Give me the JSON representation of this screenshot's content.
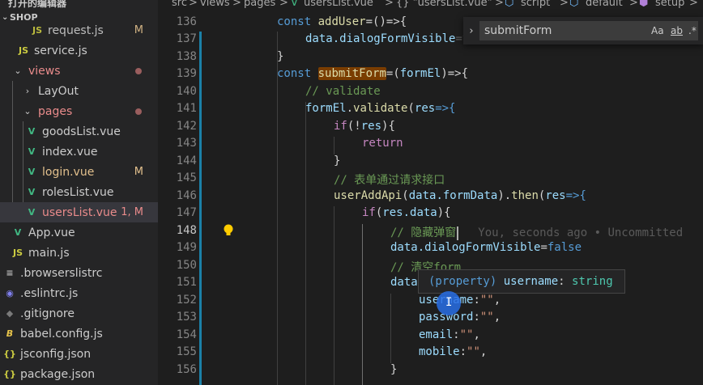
{
  "window": {
    "title": "打开的编辑器"
  },
  "sidebar": {
    "section": "SHOP",
    "items": [
      {
        "label": "request.js",
        "type": "js",
        "badge": "M",
        "partial": true
      },
      {
        "label": "service.js",
        "type": "js"
      },
      {
        "label": "views",
        "type": "folder-open",
        "dot": true
      },
      {
        "label": "LayOut",
        "type": "folder-closed"
      },
      {
        "label": "pages",
        "type": "folder-open",
        "dot": true
      },
      {
        "label": "goodsList.vue",
        "type": "vue"
      },
      {
        "label": "index.vue",
        "type": "vue"
      },
      {
        "label": "login.vue",
        "type": "vue",
        "badge": "M"
      },
      {
        "label": "rolesList.vue",
        "type": "vue"
      },
      {
        "label": "usersList.vue",
        "type": "vue",
        "badge": "1, M",
        "selected": true
      },
      {
        "label": "App.vue",
        "type": "vue"
      },
      {
        "label": "main.js",
        "type": "js"
      },
      {
        "label": ".browserslistrc",
        "type": "config"
      },
      {
        "label": ".eslintrc.js",
        "type": "eslint"
      },
      {
        "label": ".gitignore",
        "type": "git"
      },
      {
        "label": "babel.config.js",
        "type": "babel"
      },
      {
        "label": "jsconfig.json",
        "type": "json"
      },
      {
        "label": "package.json",
        "type": "json"
      }
    ]
  },
  "breadcrumb": {
    "items": [
      "src",
      "views",
      "pages",
      "usersList.vue",
      "{} \"usersList.vue\"",
      "script",
      "default",
      "setup"
    ],
    "separator": ">"
  },
  "editor": {
    "line_numbers": [
      "136",
      "137",
      "138",
      "139",
      "140",
      "141",
      "142",
      "143",
      "144",
      "145",
      "146",
      "147",
      "148",
      "149",
      "150",
      "151",
      "152",
      "153",
      "154",
      "155",
      "156"
    ],
    "lines": {
      "l136": {
        "kw": "const",
        "fn": "addUser",
        "rest": "=()=>{"
      },
      "l137": {
        "var": "data.dialogFormVisible",
        "rest": "=true"
      },
      "l138": {
        "text": "}"
      },
      "l139": {
        "kw": "const",
        "fn": "submitForm",
        "a": "=(",
        "var": "formEl",
        "b": ")=>{"
      },
      "l140": {
        "comment": "// validate"
      },
      "l141": {
        "var": "formEl",
        "a": ".",
        "fn": "validate",
        "b": "(",
        "var2": "res",
        "c": "=>{"
      },
      "l142": {
        "ctl": "if",
        "a": "(!",
        "var": "res",
        "b": "){"
      },
      "l143": {
        "ctl": "return"
      },
      "l144": {
        "text": "}"
      },
      "l145": {
        "comment": "// 表单通过请求接口"
      },
      "l146": {
        "fn": "userAddApi",
        "a": "(",
        "var": "data.formData",
        "b": ").",
        "fn2": "then",
        "c": "(",
        "var2": "res",
        "d": "=>{"
      },
      "l147": {
        "ctl": "if",
        "a": "(",
        "var": "res.data",
        "b": "){"
      },
      "l148": {
        "comment": "// 隐藏弹窗",
        "blame": "You, seconds ago • Uncommitted"
      },
      "l149": {
        "var": "data.dialogFormVisible",
        "a": "=",
        "kw": "false"
      },
      "l150": {
        "comment": "// 清空form"
      },
      "l151": {
        "var": "data"
      },
      "l152": {
        "var": "username",
        "a": ":",
        "str": "\"\"",
        "b": ","
      },
      "l153": {
        "var": "password",
        "a": ":",
        "str": "\"\"",
        "b": ","
      },
      "l154": {
        "var": "email",
        "a": ":",
        "str": "\"\"",
        "b": ","
      },
      "l155": {
        "var": "mobile",
        "a": ":",
        "str": "\"\"",
        "b": ","
      },
      "l156": {
        "text": "}"
      }
    }
  },
  "find_widget": {
    "value": "submitForm",
    "match_case": "Aa",
    "whole_word": "ab",
    "regex": ".*",
    "toggle_icon": "chevron-right-icon"
  },
  "hover": {
    "kind": "(property)",
    "name": "username",
    "sep": ":",
    "type": "string"
  },
  "colors": {
    "keyword": "#569cd6",
    "control": "#c586c0",
    "function": "#dcdcaa",
    "variable": "#9cdcfe",
    "string": "#ce9178",
    "comment": "#6a9955",
    "vue_icon": "#41b883",
    "js_icon": "#cbcb41",
    "git_modified": "#e2c08d",
    "selection_row": "#37373d"
  }
}
